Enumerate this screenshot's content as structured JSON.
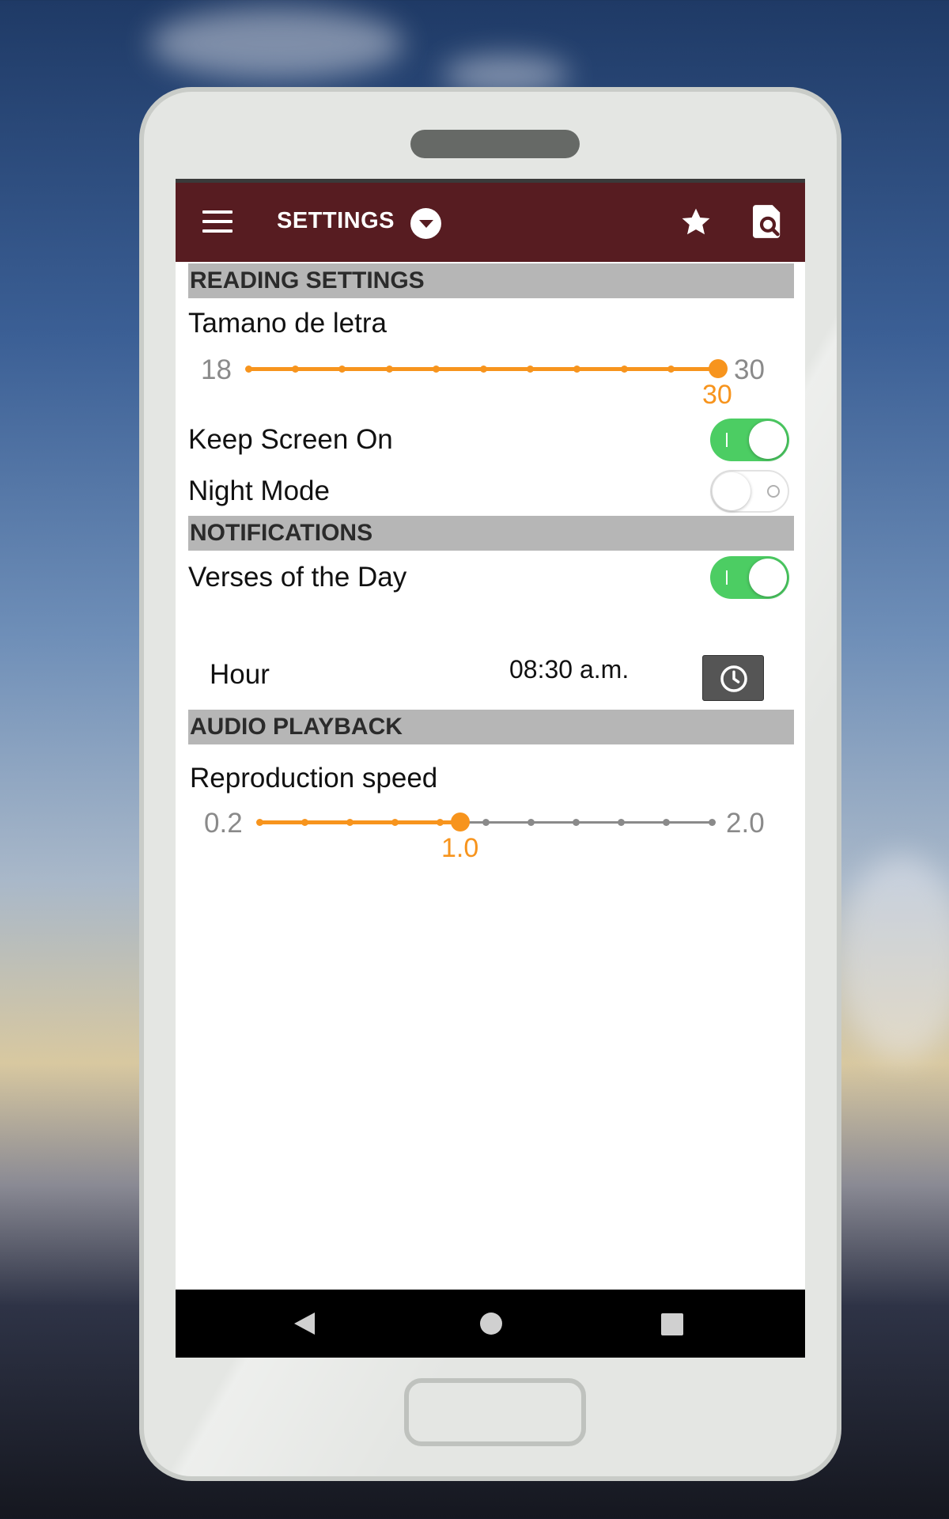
{
  "appbar": {
    "title": "SETTINGS"
  },
  "reading": {
    "header": "READING SETTINGS",
    "font_size": {
      "label": "Tamano de letra",
      "min": "18",
      "max": "30",
      "value": "30",
      "min_num": 18,
      "max_num": 30,
      "current": 30,
      "ticks": 11
    },
    "keep_screen_on": {
      "label": "Keep Screen On",
      "enabled": true
    },
    "night_mode": {
      "label": "Night Mode",
      "enabled": false
    }
  },
  "notifications": {
    "header": "NOTIFICATIONS",
    "verses_of_day": {
      "label": "Verses of the Day",
      "enabled": true
    },
    "hour": {
      "label": "Hour",
      "value": "08:30 a.m."
    }
  },
  "audio": {
    "header": "AUDIO PLAYBACK",
    "speed": {
      "label": "Reproduction speed",
      "min": "0.2",
      "max": "2.0",
      "value": "1.0",
      "min_num": 0.2,
      "max_num": 2.0,
      "current": 1.0,
      "ticks": 11
    }
  },
  "colors": {
    "appbar": "#571c21",
    "accent": "#f7941d",
    "switch_on": "#4ccd63",
    "section_bg": "#b6b6b6"
  },
  "icons": [
    "menu-icon",
    "dropdown-icon",
    "star-icon",
    "search-document-icon",
    "clock-icon",
    "back-icon",
    "home-icon",
    "recents-icon"
  ]
}
